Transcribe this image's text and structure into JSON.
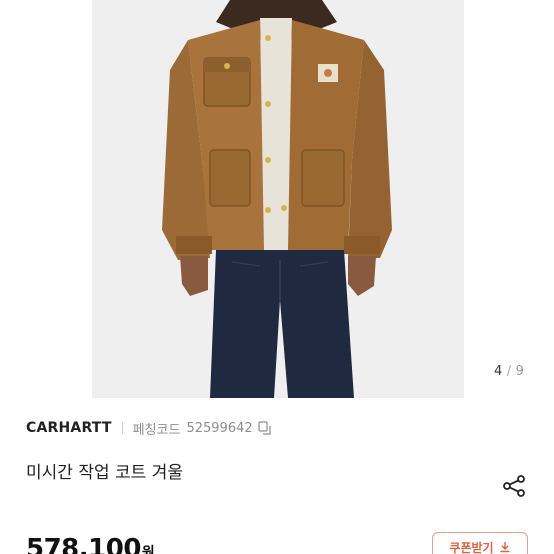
{
  "gallery": {
    "current": "4",
    "separator": "/",
    "total": "9",
    "image_alt": "jacket-product-photo"
  },
  "product": {
    "brand": "CARHARTT",
    "code_label": "페칭코드",
    "code_value": "52599642",
    "title": "미시간 작업 코트 겨울",
    "price": "578,100",
    "currency": "원"
  },
  "actions": {
    "coupon_label": "쿠폰받기",
    "share_icon": "share-icon",
    "copy_icon": "copy-icon",
    "download_icon": "download-icon"
  },
  "colors": {
    "accent": "#e2603f",
    "jacket": "#a8733c",
    "denim": "#1f2a40"
  }
}
